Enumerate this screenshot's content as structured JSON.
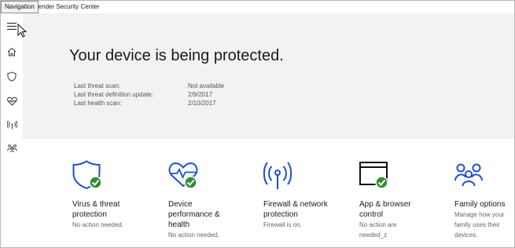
{
  "window": {
    "title": "efender Security Center"
  },
  "tooltip": {
    "text": "Navigation"
  },
  "sidebar": {
    "items": [
      {
        "name": "menu",
        "icon": "hamburger-menu-icon"
      },
      {
        "name": "home",
        "icon": "home-icon"
      },
      {
        "name": "virus",
        "icon": "shield-icon"
      },
      {
        "name": "health",
        "icon": "heart-pulse-icon"
      },
      {
        "name": "firewall",
        "icon": "wifi-antenna-icon"
      },
      {
        "name": "family",
        "icon": "family-icon"
      }
    ]
  },
  "hero": {
    "title": "Your device is being protected.",
    "scans": [
      {
        "label": "Last threat scan:",
        "value": "Not available"
      },
      {
        "label": "Last threat definition update:",
        "value": "2/9/2017"
      },
      {
        "label": "Last health scan:",
        "value": "2/10/2017"
      }
    ]
  },
  "tiles": [
    {
      "icon": "shield-check-icon",
      "name_lines": [
        "Virus & threat",
        "protection"
      ],
      "status_lines": [
        "No action needed."
      ]
    },
    {
      "icon": "heart-pulse-check-icon",
      "name_lines": [
        "Device",
        "performance &",
        "health"
      ],
      "status_lines": [
        "No action needed."
      ]
    },
    {
      "icon": "wireless-antenna-icon",
      "name_lines": [
        "Firewall & network",
        "protection"
      ],
      "status_lines": [
        "Firewall is on."
      ]
    },
    {
      "icon": "browser-window-check-icon",
      "name_lines": [
        "App & browser",
        "control"
      ],
      "status_lines": [
        "No action are",
        "needed_z"
      ]
    },
    {
      "icon": "family-group-icon",
      "name_lines": [
        "Family options"
      ],
      "status_lines": [
        "Manage how your",
        "family uses their",
        "devices."
      ]
    }
  ],
  "colors": {
    "accent_blue": "#1f4fcf",
    "check_green": "#2f8f2f",
    "hero_background": "#f2f2f2",
    "sidebar_icon": "#333333"
  }
}
